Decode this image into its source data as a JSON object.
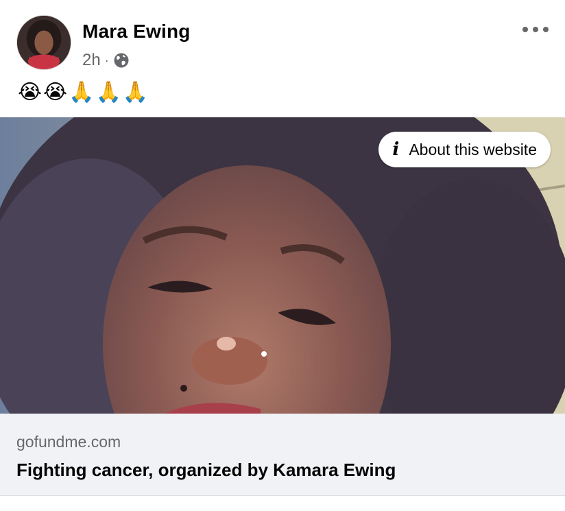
{
  "post": {
    "author": "Mara Ewing",
    "time": "2h",
    "separator": "·",
    "audience_icon": "globe-icon",
    "more_icon": "more-options-icon",
    "message": "😭😭🙏🙏🙏"
  },
  "media": {
    "about_label": "About this website",
    "about_icon": "info-icon"
  },
  "link_preview": {
    "domain": "gofundme.com",
    "title": "Fighting cancer, organized by Kamara Ewing"
  },
  "colors": {
    "secondary_text": "#65676b",
    "preview_bg": "#f0f2f5"
  }
}
